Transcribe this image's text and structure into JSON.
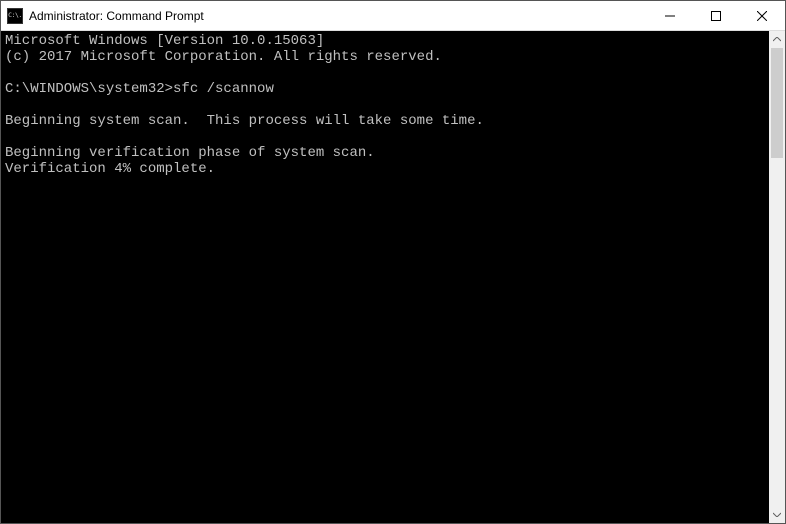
{
  "window": {
    "title": "Administrator: Command Prompt",
    "icon_text": "C:\\."
  },
  "terminal": {
    "lines": [
      "Microsoft Windows [Version 10.0.15063]",
      "(c) 2017 Microsoft Corporation. All rights reserved.",
      "",
      "C:\\WINDOWS\\system32>sfc /scannow",
      "",
      "Beginning system scan.  This process will take some time.",
      "",
      "Beginning verification phase of system scan.",
      "Verification 4% complete."
    ]
  }
}
